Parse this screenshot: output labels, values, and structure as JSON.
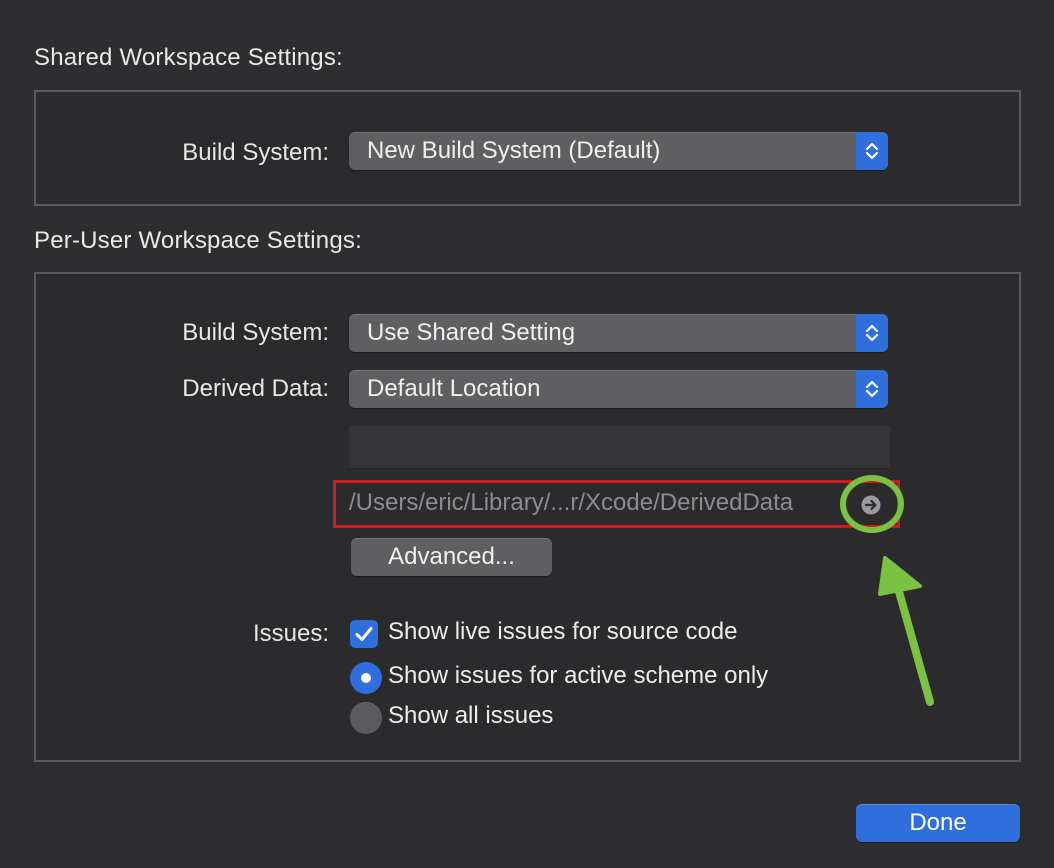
{
  "shared_section": {
    "title": "Shared Workspace Settings:",
    "build_system_label": "Build System:",
    "build_system_value": "New Build System (Default)"
  },
  "per_user_section": {
    "title": "Per-User Workspace Settings:",
    "build_system_label": "Build System:",
    "build_system_value": "Use Shared Setting",
    "derived_data_label": "Derived Data:",
    "derived_data_value": "Default Location",
    "custom_path_value": "",
    "derived_data_path": "/Users/eric/Library/...r/Xcode/DerivedData",
    "advanced_label": "Advanced...",
    "issues_label": "Issues:",
    "issues_options": [
      {
        "label": "Show live issues for source code",
        "type": "checkbox",
        "checked": true
      },
      {
        "label": "Show issues for active scheme only",
        "type": "radio",
        "checked": true
      },
      {
        "label": "Show all issues",
        "type": "radio",
        "checked": false
      }
    ]
  },
  "footer": {
    "done_label": "Done"
  },
  "icons": {
    "popup_stepper": "up-down-chevron-icon",
    "reveal": "arrow-circle-right-icon",
    "checkmark": "checkmark-icon"
  },
  "colors": {
    "background": "#2e2e30",
    "accent": "#2f6fdb",
    "annotation_red": "#d11a1a",
    "annotation_green": "#7bc143"
  }
}
